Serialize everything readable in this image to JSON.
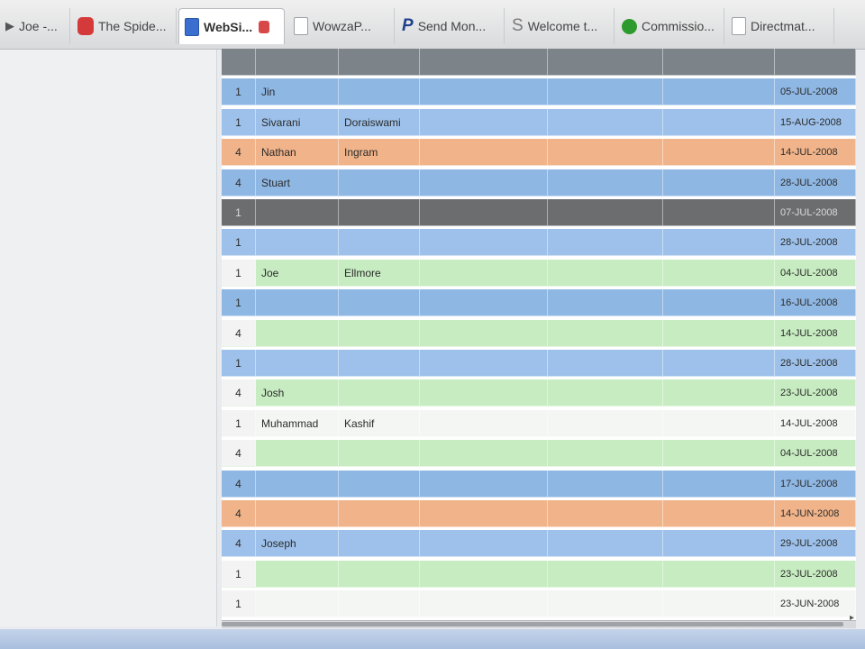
{
  "tabs": [
    {
      "label": "Joe -...",
      "icon": "arrow-icon",
      "active": false
    },
    {
      "label": "The Spide...",
      "icon": "spider-icon",
      "active": false
    },
    {
      "label": "WebSi...",
      "icon": "document-icon",
      "active": true
    },
    {
      "label": "WowzaP...",
      "icon": "page-icon",
      "active": false
    },
    {
      "label": "Send Mon...",
      "icon": "paypal-icon",
      "active": false
    },
    {
      "label": "Welcome t...",
      "icon": "s-logo-icon",
      "active": false
    },
    {
      "label": "Commissio...",
      "icon": "green-ball-icon",
      "active": false
    },
    {
      "label": "Directmat...",
      "icon": "page-icon",
      "active": false
    }
  ],
  "grid": {
    "rows": [
      {
        "style": "header",
        "cells": [
          "",
          "",
          "",
          "",
          "",
          "",
          ""
        ]
      },
      {
        "style": "blue",
        "cells": [
          "1",
          "Jin",
          "",
          "",
          "",
          "",
          "05-JUL-2008"
        ]
      },
      {
        "style": "blue2",
        "cells": [
          "1",
          "Sivarani",
          "Doraiswami",
          "",
          "",
          "",
          "15-AUG-2008"
        ]
      },
      {
        "style": "orange",
        "cells": [
          "4",
          "Nathan",
          "Ingram",
          "",
          "",
          "",
          "14-JUL-2008"
        ]
      },
      {
        "style": "blue",
        "cells": [
          "4",
          "Stuart",
          "",
          "",
          "",
          "",
          "28-JUL-2008"
        ]
      },
      {
        "style": "dark",
        "cells": [
          "1",
          "",
          "",
          "",
          "",
          "",
          "07-JUL-2008"
        ]
      },
      {
        "style": "blue2",
        "cells": [
          "1",
          "",
          "",
          "",
          "",
          "",
          "28-JUL-2008"
        ]
      },
      {
        "style": "green",
        "cells": [
          "1",
          "Joe",
          "Ellmore",
          "",
          "",
          "",
          "04-JUL-2008"
        ]
      },
      {
        "style": "blue",
        "cells": [
          "1",
          "",
          "",
          "",
          "",
          "",
          "16-JUL-2008"
        ]
      },
      {
        "style": "green",
        "cells": [
          "4",
          "",
          "",
          "",
          "",
          "",
          "14-JUL-2008"
        ]
      },
      {
        "style": "blue2",
        "cells": [
          "1",
          "",
          "",
          "",
          "",
          "",
          "28-JUL-2008"
        ]
      },
      {
        "style": "green",
        "cells": [
          "4",
          "Josh",
          "",
          "",
          "",
          "",
          "23-JUL-2008"
        ]
      },
      {
        "style": "white",
        "cells": [
          "1",
          "Muhammad",
          "Kashif",
          "",
          "",
          "",
          "14-JUL-2008"
        ]
      },
      {
        "style": "green",
        "cells": [
          "4",
          "",
          "",
          "",
          "",
          "",
          "04-JUL-2008"
        ]
      },
      {
        "style": "blue",
        "cells": [
          "4",
          "",
          "",
          "",
          "",
          "",
          "17-JUL-2008"
        ]
      },
      {
        "style": "orange",
        "cells": [
          "4",
          "",
          "",
          "",
          "",
          "",
          "14-JUN-2008"
        ]
      },
      {
        "style": "blue2",
        "cells": [
          "4",
          "Joseph",
          "",
          "",
          "",
          "",
          "29-JUL-2008"
        ]
      },
      {
        "style": "green",
        "cells": [
          "1",
          "",
          "",
          "",
          "",
          "",
          "23-JUL-2008"
        ]
      },
      {
        "style": "white",
        "cells": [
          "1",
          "",
          "",
          "",
          "",
          "",
          "23-JUN-2008"
        ]
      }
    ]
  }
}
